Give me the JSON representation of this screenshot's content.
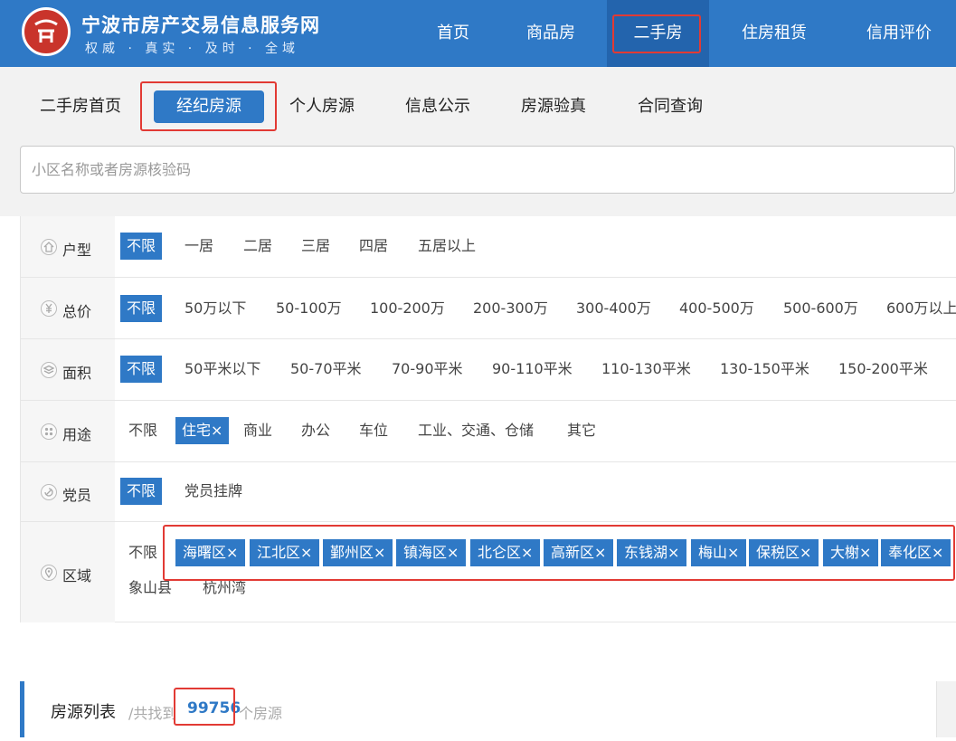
{
  "header": {
    "title": "宁波市房产交易信息服务网",
    "slogan": "权威 · 真实 · 及时 · 全域",
    "logo_icon": "seal-logo-icon",
    "nav": [
      {
        "label": "首页"
      },
      {
        "label": "商品房"
      },
      {
        "label": "二手房",
        "active": true
      },
      {
        "label": "住房租赁"
      },
      {
        "label": "信用评价"
      }
    ]
  },
  "subnav": {
    "items": [
      "二手房首页",
      "经纪房源",
      "个人房源",
      "信息公示",
      "房源验真",
      "合同查询"
    ],
    "active": "经纪房源"
  },
  "search": {
    "placeholder": "小区名称或者房源核验码",
    "value": ""
  },
  "filters": {
    "layout": {
      "label": "户型",
      "icon": "house-icon",
      "options": [
        "不限",
        "一居",
        "二居",
        "三居",
        "四居",
        "五居以上"
      ],
      "selected": "不限"
    },
    "price": {
      "label": "总价",
      "icon": "yen-icon",
      "options": [
        "不限",
        "50万以下",
        "50-100万",
        "100-200万",
        "200-300万",
        "300-400万",
        "400-500万",
        "500-600万",
        "600万以上"
      ],
      "selected": "不限"
    },
    "area": {
      "label": "面积",
      "icon": "stack-icon",
      "options": [
        "不限",
        "50平米以下",
        "50-70平米",
        "70-90平米",
        "90-110平米",
        "110-130平米",
        "130-150平米",
        "150-200平米"
      ],
      "selected": "不限"
    },
    "usage": {
      "label": "用途",
      "icon": "grid-dots-icon",
      "options": [
        "不限",
        "住宅",
        "商业",
        "办公",
        "车位",
        "工业、交通、仓储",
        "其它"
      ],
      "selected": "住宅"
    },
    "party": {
      "label": "党员",
      "icon": "party-emblem-icon",
      "options": [
        "不限",
        "党员挂牌"
      ],
      "selected": "不限"
    },
    "district": {
      "label": "区域",
      "icon": "map-pin-icon",
      "unlimited": "不限",
      "selected": [
        "海曙区",
        "江北区",
        "鄞州区",
        "镇海区",
        "北仑区",
        "高新区",
        "东钱湖",
        "梅山",
        "保税区",
        "大榭",
        "奉化区"
      ],
      "unselected": [
        "象山县",
        "杭州湾"
      ]
    },
    "remove_mark": "×"
  },
  "results": {
    "title": "房源列表",
    "prefix": "/共找到",
    "count": "99756",
    "suffix": "个房源"
  },
  "colors": {
    "brand_blue": "#2f79c6",
    "highlight_red": "#e23a34"
  }
}
